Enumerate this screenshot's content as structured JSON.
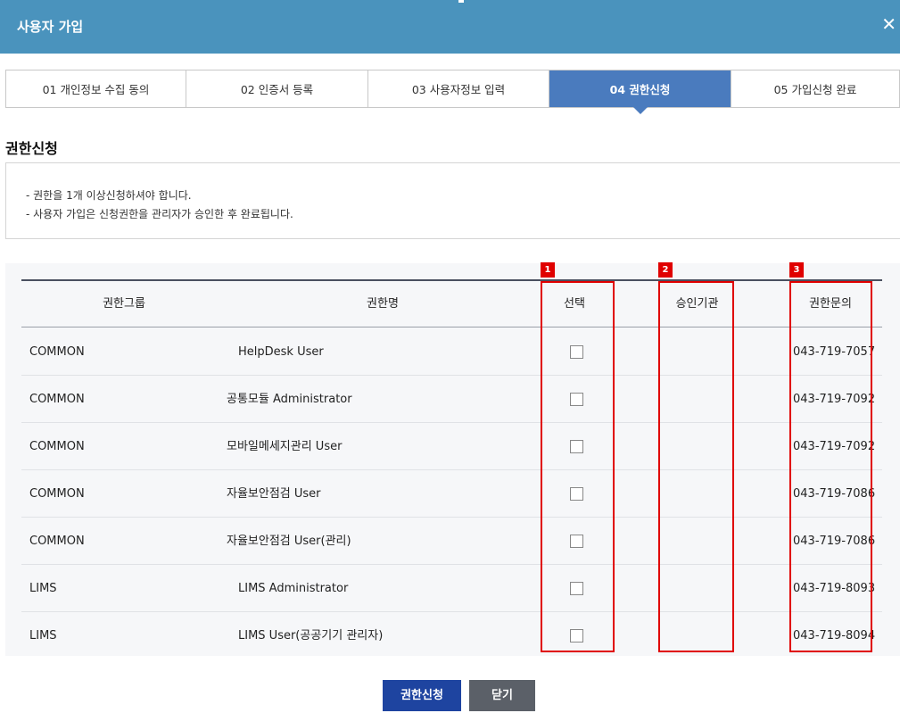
{
  "window": {
    "title": "사용자 가입",
    "close_label": "✕"
  },
  "steps": [
    {
      "label": "01 개인정보 수집 동의",
      "active": false
    },
    {
      "label": "02 인증서 등록",
      "active": false
    },
    {
      "label": "03 사용자정보 입력",
      "active": false
    },
    {
      "label": "04 권한신청",
      "active": true
    },
    {
      "label": "05 가입신청 완료",
      "active": false
    }
  ],
  "section": {
    "title": "권한신청",
    "notices": [
      "- 권한을 1개 이상신청하셔야 합니다.",
      "- 사용자 가입은 신청권한을 관리자가 승인한 후 완료됩니다."
    ]
  },
  "table": {
    "headers": {
      "group": "권한그룹",
      "name": "권한명",
      "select": "선택",
      "approver": "승인기관",
      "contact": "권한문의"
    },
    "rows": [
      {
        "group": "COMMON",
        "name": "HelpDesk User",
        "checked": false,
        "approver": "",
        "contact": "043-719-7057"
      },
      {
        "group": "COMMON",
        "name": "공통모듈 Administrator",
        "checked": false,
        "approver": "",
        "contact": "043-719-7092"
      },
      {
        "group": "COMMON",
        "name": "모바일메세지관리 User",
        "checked": false,
        "approver": "",
        "contact": "043-719-7092"
      },
      {
        "group": "COMMON",
        "name": "자율보안점검 User",
        "checked": false,
        "approver": "",
        "contact": "043-719-7086"
      },
      {
        "group": "COMMON",
        "name": "자율보안점검 User(관리)",
        "checked": false,
        "approver": "",
        "contact": "043-719-7086"
      },
      {
        "group": "LIMS",
        "name": "LIMS Administrator",
        "checked": false,
        "approver": "",
        "contact": "043-719-8093"
      },
      {
        "group": "LIMS",
        "name": "LIMS User(공공기기 관리자)",
        "checked": false,
        "approver": "",
        "contact": "043-719-8094"
      }
    ]
  },
  "annotations": [
    {
      "number": "1"
    },
    {
      "number": "2"
    },
    {
      "number": "3"
    }
  ],
  "buttons": {
    "submit": "권한신청",
    "close": "닫기"
  },
  "colors": {
    "titlebar": "#4a93bd",
    "active_step": "#4a7bbe",
    "primary_button": "#1e44a0",
    "secondary_button": "#5b6068",
    "annotation": "#e00000"
  }
}
